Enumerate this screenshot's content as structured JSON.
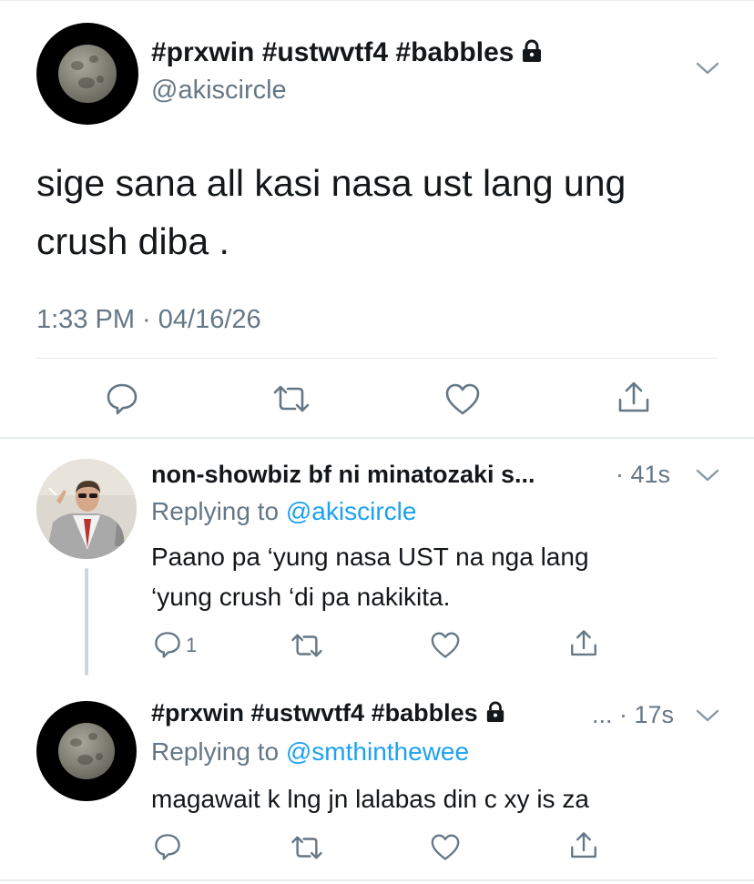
{
  "main_tweet": {
    "display_name": "#prxwin #ustwvtf4 #babbles",
    "handle": "@akiscircle",
    "text_line1": "sige sana all kasi nasa ust lang ung",
    "text_line2": "crush diba .",
    "timestamp": "1:33 PM · 04/16/26",
    "avatar": "moon-avatar",
    "protected": true
  },
  "replies": [
    {
      "display_name": "non-showbiz bf ni minatozaki s...",
      "time": "· 41s",
      "replying_prefix": "Replying to",
      "replying_to": "@akiscircle",
      "text_line1": "Paano pa ‘yung nasa UST na nga lang",
      "text_line2": "‘yung crush ‘di pa nakikita.",
      "reply_count": "1",
      "avatar": "photo-avatar"
    },
    {
      "display_name": "#prxwin #ustwvtf4 #babbles",
      "time": "... · 17s",
      "replying_prefix": "Replying to",
      "replying_to": "@smthinthewee",
      "text_line1": "magawait k lng jn lalabas din c xy is za",
      "reply_count": "",
      "avatar": "moon-avatar"
    }
  ],
  "icons": {
    "reply": "reply-icon",
    "retweet": "retweet-icon",
    "like": "heart-icon",
    "share": "share-icon",
    "more": "chevron-down-icon",
    "lock": "lock-icon"
  },
  "colors": {
    "text": "#14171a",
    "muted": "#657786",
    "link": "#1da1f2",
    "divider": "#e6ecf0",
    "thread": "#ccd6dd"
  }
}
